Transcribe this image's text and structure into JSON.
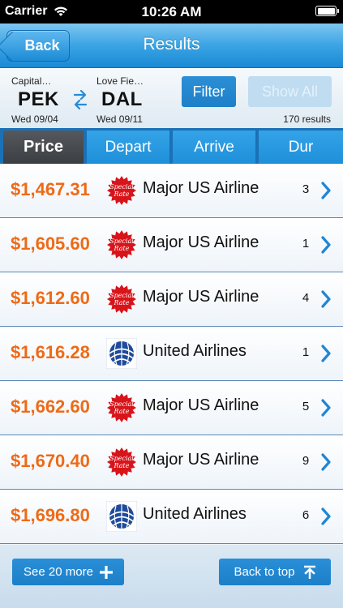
{
  "status_bar": {
    "carrier": "Carrier",
    "time": "10:26 AM"
  },
  "nav": {
    "back_label": "Back",
    "title": "Results"
  },
  "route": {
    "origin_city": "Capital…",
    "origin_code": "PEK",
    "origin_date": "Wed 09/04",
    "dest_city": "Love Fie…",
    "dest_code": "DAL",
    "dest_date": "Wed 09/11",
    "filter_label": "Filter",
    "show_all_label": "Show All",
    "results_count": "170 results"
  },
  "tabs": [
    {
      "label": "Price",
      "active": true
    },
    {
      "label": "Depart",
      "active": false
    },
    {
      "label": "Arrive",
      "active": false
    },
    {
      "label": "Dur",
      "active": false
    }
  ],
  "results": [
    {
      "price": "$1,467.31",
      "logo": "special-rate-icon",
      "airline": "Major US Airline",
      "count": "3"
    },
    {
      "price": "$1,605.60",
      "logo": "special-rate-icon",
      "airline": "Major US Airline",
      "count": "1"
    },
    {
      "price": "$1,612.60",
      "logo": "special-rate-icon",
      "airline": "Major US Airline",
      "count": "4"
    },
    {
      "price": "$1,616.28",
      "logo": "united-globe-icon",
      "airline": "United Airlines",
      "count": "1"
    },
    {
      "price": "$1,662.60",
      "logo": "special-rate-icon",
      "airline": "Major US Airline",
      "count": "5"
    },
    {
      "price": "$1,670.40",
      "logo": "special-rate-icon",
      "airline": "Major US Airline",
      "count": "9"
    },
    {
      "price": "$1,696.80",
      "logo": "united-globe-icon",
      "airline": "United Airlines",
      "count": "6"
    }
  ],
  "bottom": {
    "more_label": "See 20 more",
    "top_label": "Back to top"
  },
  "colors": {
    "accent": "#1c86d0",
    "price": "#ee6a17",
    "nav": "#3aa4e4",
    "active_tab": "#4a4d51"
  }
}
